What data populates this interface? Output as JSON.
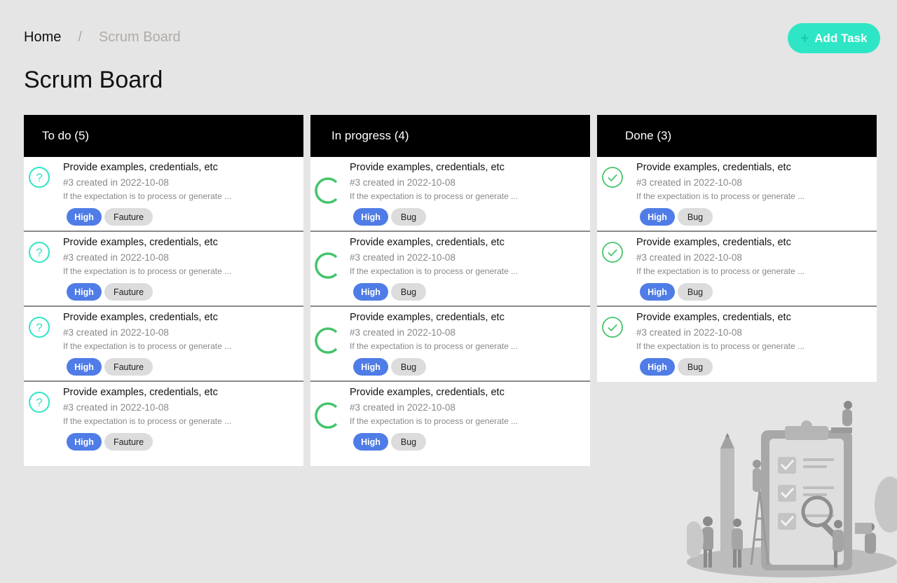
{
  "breadcrumb": {
    "home": "Home",
    "separator": "/",
    "current": "Scrum Board"
  },
  "actions": {
    "add_task": "Add Task",
    "add_icon": "plus-icon"
  },
  "page": {
    "title": "Scrum Board"
  },
  "colors": {
    "accent": "#2ee6c5",
    "priority_high": "#4f7ce6",
    "status_todo": "#2ee6c5",
    "status_progress": "#45c46c",
    "status_done": "#45c46c",
    "header_bg": "#000000"
  },
  "columns": [
    {
      "label": "To do (5)",
      "status_icon": "question-circle-icon",
      "cards": [
        {
          "title": "Provide examples, credentials, etc",
          "meta": "#3 created in 2022-10-08",
          "description": "If the expectation is to process or generate ...",
          "priority": "High",
          "type": "Fauture"
        },
        {
          "title": "Provide examples, credentials, etc",
          "meta": "#3 created in 2022-10-08",
          "description": "If the expectation is to process or generate ...",
          "priority": "High",
          "type": "Fauture"
        },
        {
          "title": "Provide examples, credentials, etc",
          "meta": "#3 created in 2022-10-08",
          "description": "If the expectation is to process or generate ...",
          "priority": "High",
          "type": "Fauture"
        },
        {
          "title": "Provide examples, credentials, etc",
          "meta": "#3 created in 2022-10-08",
          "description": "If the expectation is to process or generate ...",
          "priority": "High",
          "type": "Fauture"
        }
      ]
    },
    {
      "label": "In progress (4)",
      "status_icon": "progress-ring-icon",
      "cards": [
        {
          "title": "Provide examples, credentials, etc",
          "meta": "#3 created in 2022-10-08",
          "description": "If the expectation is to process or generate ...",
          "priority": "High",
          "type": "Bug"
        },
        {
          "title": "Provide examples, credentials, etc",
          "meta": "#3 created in 2022-10-08",
          "description": "If the expectation is to process or generate ...",
          "priority": "High",
          "type": "Bug"
        },
        {
          "title": "Provide examples, credentials, etc",
          "meta": "#3 created in 2022-10-08",
          "description": "If the expectation is to process or generate ...",
          "priority": "High",
          "type": "Bug"
        },
        {
          "title": "Provide examples, credentials, etc",
          "meta": "#3 created in 2022-10-08",
          "description": "If the expectation is to process or generate ...",
          "priority": "High",
          "type": "Bug"
        }
      ]
    },
    {
      "label": "Done (3)",
      "status_icon": "check-circle-icon",
      "cards": [
        {
          "title": "Provide examples, credentials, etc",
          "meta": "#3 created in 2022-10-08",
          "description": "If the expectation is to process or generate ...",
          "priority": "High",
          "type": "Bug"
        },
        {
          "title": "Provide examples, credentials, etc",
          "meta": "#3 created in 2022-10-08",
          "description": "If the expectation is to process or generate ...",
          "priority": "High",
          "type": "Bug"
        },
        {
          "title": "Provide examples, credentials, etc",
          "meta": "#3 created in 2022-10-08",
          "description": "If the expectation is to process or generate ...",
          "priority": "High",
          "type": "Bug"
        }
      ]
    }
  ],
  "illustration": {
    "icon": "task-checklist-illustration"
  }
}
